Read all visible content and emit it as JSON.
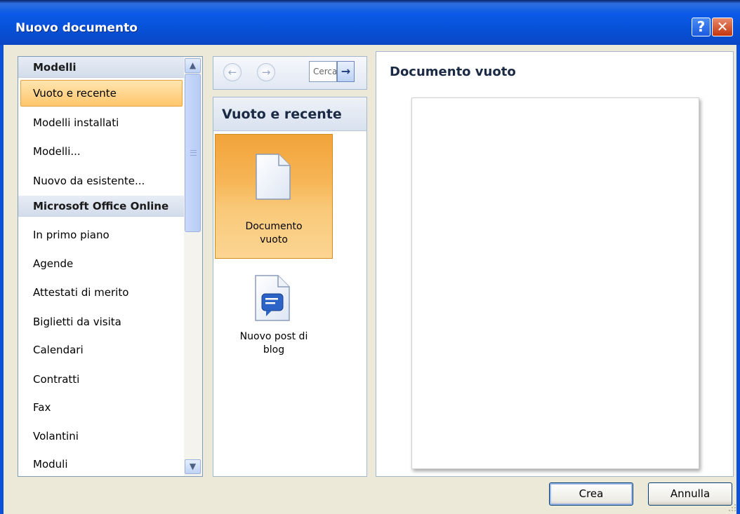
{
  "window": {
    "title": "Nuovo documento"
  },
  "title_buttons": {
    "help": "?",
    "close": "✕"
  },
  "left_panel": {
    "groups": [
      {
        "header": "Modelli",
        "items": [
          "Vuoto e recente",
          "Modelli installati",
          "Modelli...",
          "Nuovo da esistente..."
        ]
      },
      {
        "header": "Microsoft Office Online",
        "items": [
          "In primo piano",
          "Agende",
          "Attestati di merito",
          "Biglietti da visita",
          "Calendari",
          "Contratti",
          "Fax",
          "Volantini",
          "Moduli"
        ]
      }
    ],
    "selected_item": "Vuoto e recente"
  },
  "toolbar": {
    "back": "←",
    "forward": "→",
    "search_text": "Cerca",
    "search_go": "→"
  },
  "middle_panel": {
    "header": "Vuoto e recente",
    "tiles": [
      {
        "line1": "Documento",
        "line2": "vuoto",
        "icon": "blank-document-icon"
      },
      {
        "line1": "Nuovo post di",
        "line2": "blog",
        "icon": "blog-post-icon"
      }
    ]
  },
  "preview": {
    "title": "Documento vuoto"
  },
  "buttons": {
    "create": "Crea",
    "cancel": "Annulla"
  },
  "colors": {
    "titlebar": "#0B5AE8",
    "selection": "#FFC66C",
    "tile_selected": "#F6B556"
  }
}
